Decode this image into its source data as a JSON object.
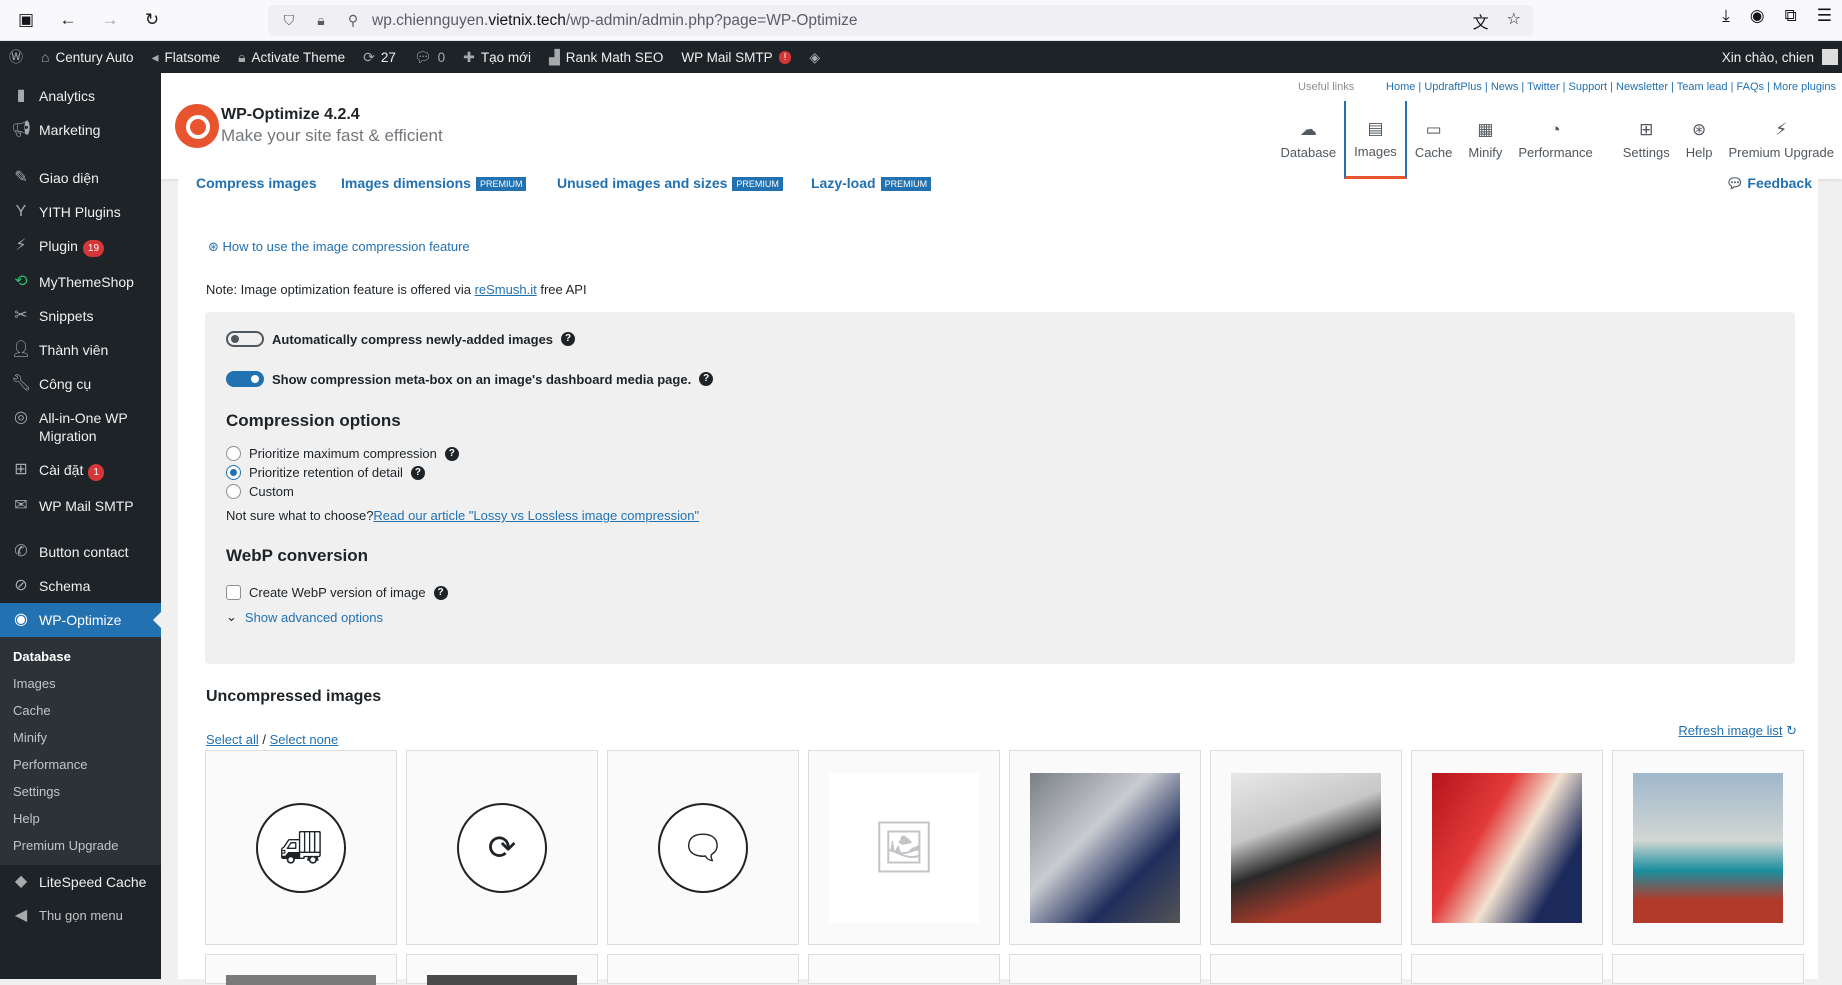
{
  "browser": {
    "url_prefix": "wp.chiennguyen.",
    "url_domain": "vietnix.tech",
    "url_path": "/wp-admin/admin.php?page=WP-Optimize"
  },
  "adminbar": {
    "site": "Century Auto",
    "flatsome": "Flatsome",
    "activate": "Activate Theme",
    "updates": "27",
    "comments": "0",
    "new": "Tạo mới",
    "rankmath": "Rank Math SEO",
    "smtp": "WP Mail SMTP",
    "smtp_badge": "!",
    "greeting": "Xin chào, chien"
  },
  "sidebar": {
    "items": [
      {
        "label": "Analytics"
      },
      {
        "label": "Marketing"
      },
      {
        "label": "Giao diện"
      },
      {
        "label": "YITH Plugins"
      },
      {
        "label": "Plugin",
        "badge": "19"
      },
      {
        "label": "MyThemeShop"
      },
      {
        "label": "Snippets"
      },
      {
        "label": "Thành viên"
      },
      {
        "label": "Công cụ"
      },
      {
        "label": "All-in-One WP Migration"
      },
      {
        "label": "Cài đặt",
        "badge": "1"
      },
      {
        "label": "WP Mail SMTP"
      },
      {
        "label": "Button contact"
      },
      {
        "label": "Schema"
      },
      {
        "label": "WP-Optimize"
      }
    ],
    "sub": [
      "Database",
      "Images",
      "Cache",
      "Minify",
      "Performance",
      "Settings",
      "Help",
      "Premium Upgrade"
    ],
    "after": [
      {
        "label": "LiteSpeed Cache"
      },
      {
        "label": "Thu gọn menu"
      }
    ]
  },
  "header": {
    "title": "WP-Optimize 4.2.4",
    "subtitle": "Make your site fast & efficient",
    "useful": "Useful links",
    "links": [
      "Home",
      "UpdraftPlus",
      "News",
      "Twitter",
      "Support",
      "Newsletter",
      "Team lead",
      "FAQs",
      "More plugins"
    ],
    "nav": [
      "Database",
      "Images",
      "Cache",
      "Minify",
      "Performance",
      "Settings",
      "Help",
      "Premium Upgrade"
    ]
  },
  "tabs": {
    "compress": "Compress images",
    "dimensions": "Images dimensions",
    "unused": "Unused images and sizes",
    "lazy": "Lazy-load",
    "premium": "PREMIUM",
    "feedback": "Feedback"
  },
  "content": {
    "howto": "How to use the image compression feature",
    "note_pre": "Note: Image optimization feature is offered via ",
    "note_link": "reSmush.it",
    "note_post": " free API",
    "auto": "Automatically compress newly-added images",
    "metabox": "Show compression meta-box on an image's dashboard media page.",
    "comp_title": "Compression options",
    "opt1": "Prioritize maximum compression",
    "opt2": "Prioritize retention of detail",
    "opt3": "Custom",
    "notsure": "Not sure what to choose? ",
    "article": "Read our article \"Lossy vs Lossless image compression\"",
    "webp_title": "WebP conversion",
    "webp": "Create WebP version of image",
    "advanced": "Show advanced options",
    "uncompressed": "Uncompressed images",
    "select_all": "Select all",
    "select_none": "Select none",
    "refresh": "Refresh image list"
  },
  "images": [
    "truck-icon",
    "box-cycle-icon",
    "chat-icon",
    "placeholder-image",
    "mechanic-photo",
    "mechanic-clipboard-photo",
    "mechanic-tire-photo",
    "sports-cars-photo"
  ]
}
